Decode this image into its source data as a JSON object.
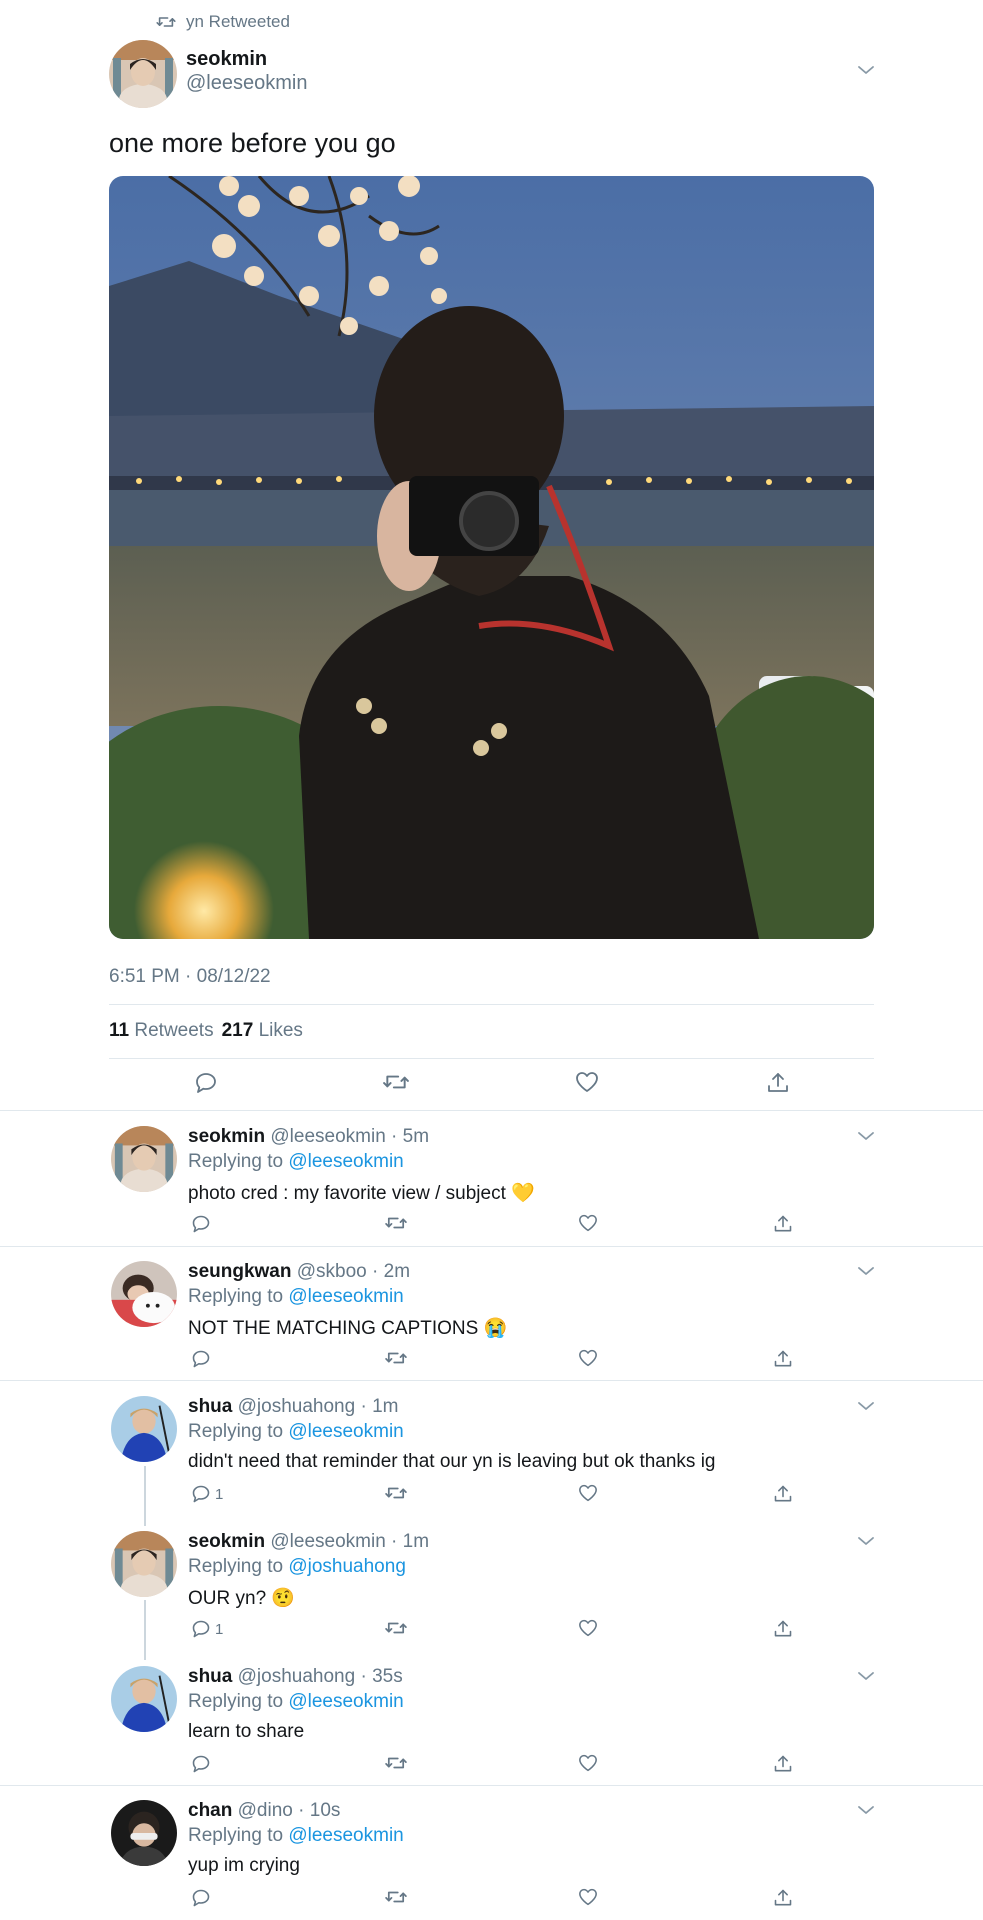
{
  "main_tweet": {
    "retweeted_by": "yn Retweeted",
    "display_name": "seokmin",
    "handle": "@leeseokmin",
    "text": "one more before you go",
    "timestamp": "6:51 PM · 08/12/22",
    "retweets_count": "11",
    "retweets_label": "Retweets",
    "likes_count": "217",
    "likes_label": "Likes"
  },
  "replies": [
    {
      "display_name": "seokmin",
      "handle": "@leeseokmin",
      "time": "5m",
      "replying_prefix": "Replying to",
      "replying_to": "@leeseokmin",
      "text": "photo cred : my favorite view / subject 💛",
      "reply_count": ""
    },
    {
      "display_name": "seungkwan",
      "handle": "@skboo",
      "time": "2m",
      "replying_prefix": "Replying to",
      "replying_to": "@leeseokmin",
      "text": "NOT THE MATCHING CAPTIONS 😭",
      "reply_count": ""
    },
    {
      "display_name": "shua",
      "handle": "@joshuahong",
      "time": "1m",
      "replying_prefix": "Replying to",
      "replying_to": "@leeseokmin",
      "text": "didn't need that reminder that our yn is leaving but ok thanks ig",
      "reply_count": "1"
    },
    {
      "display_name": "seokmin",
      "handle": "@leeseokmin",
      "time": "1m",
      "replying_prefix": "Replying to",
      "replying_to": "@joshuahong",
      "text": "OUR yn? 🤨",
      "reply_count": "1"
    },
    {
      "display_name": "shua",
      "handle": "@joshuahong",
      "time": "35s",
      "replying_prefix": "Replying to",
      "replying_to": "@leeseokmin",
      "text": "learn to share",
      "reply_count": ""
    },
    {
      "display_name": "chan",
      "handle": "@dino",
      "time": "10s",
      "replying_prefix": "Replying to",
      "replying_to": "@leeseokmin",
      "text": "yup im crying",
      "reply_count": ""
    }
  ],
  "icons": {
    "retweet": "retweet-icon",
    "reply": "reply-icon",
    "like": "heart-icon",
    "share": "share-icon",
    "more": "chevron-down-icon"
  },
  "colors": {
    "text": "#14171a",
    "muted": "#657786",
    "link": "#1b95e0",
    "divider": "#e1e8ed"
  }
}
